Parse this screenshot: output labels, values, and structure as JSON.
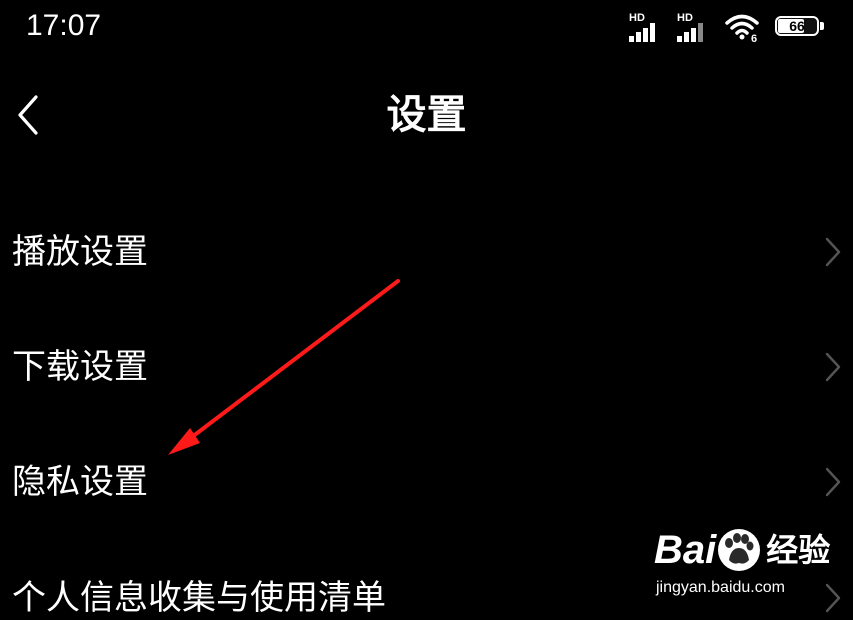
{
  "status_bar": {
    "time": "17:07",
    "signal_1_label": "HD",
    "signal_2_label": "HD",
    "wifi_badge": "6",
    "battery_level": "66"
  },
  "header": {
    "title": "设置",
    "back_icon": "chevron-left-icon"
  },
  "menu": {
    "items": [
      {
        "label": "播放设置",
        "icon": "chevron-right-icon"
      },
      {
        "label": "下载设置",
        "icon": "chevron-right-icon"
      },
      {
        "label": "隐私设置",
        "icon": "chevron-right-icon"
      },
      {
        "label": "个人信息收集与使用清单",
        "icon": "chevron-right-icon"
      }
    ]
  },
  "annotation": {
    "arrow_color": "#ff1a1a"
  },
  "watermark": {
    "brand_left": "Bai",
    "brand_right": "经验",
    "url": "jingyan.baidu.com"
  },
  "colors": {
    "background": "#000000",
    "text": "#ffffff",
    "chevron": "#555555"
  }
}
